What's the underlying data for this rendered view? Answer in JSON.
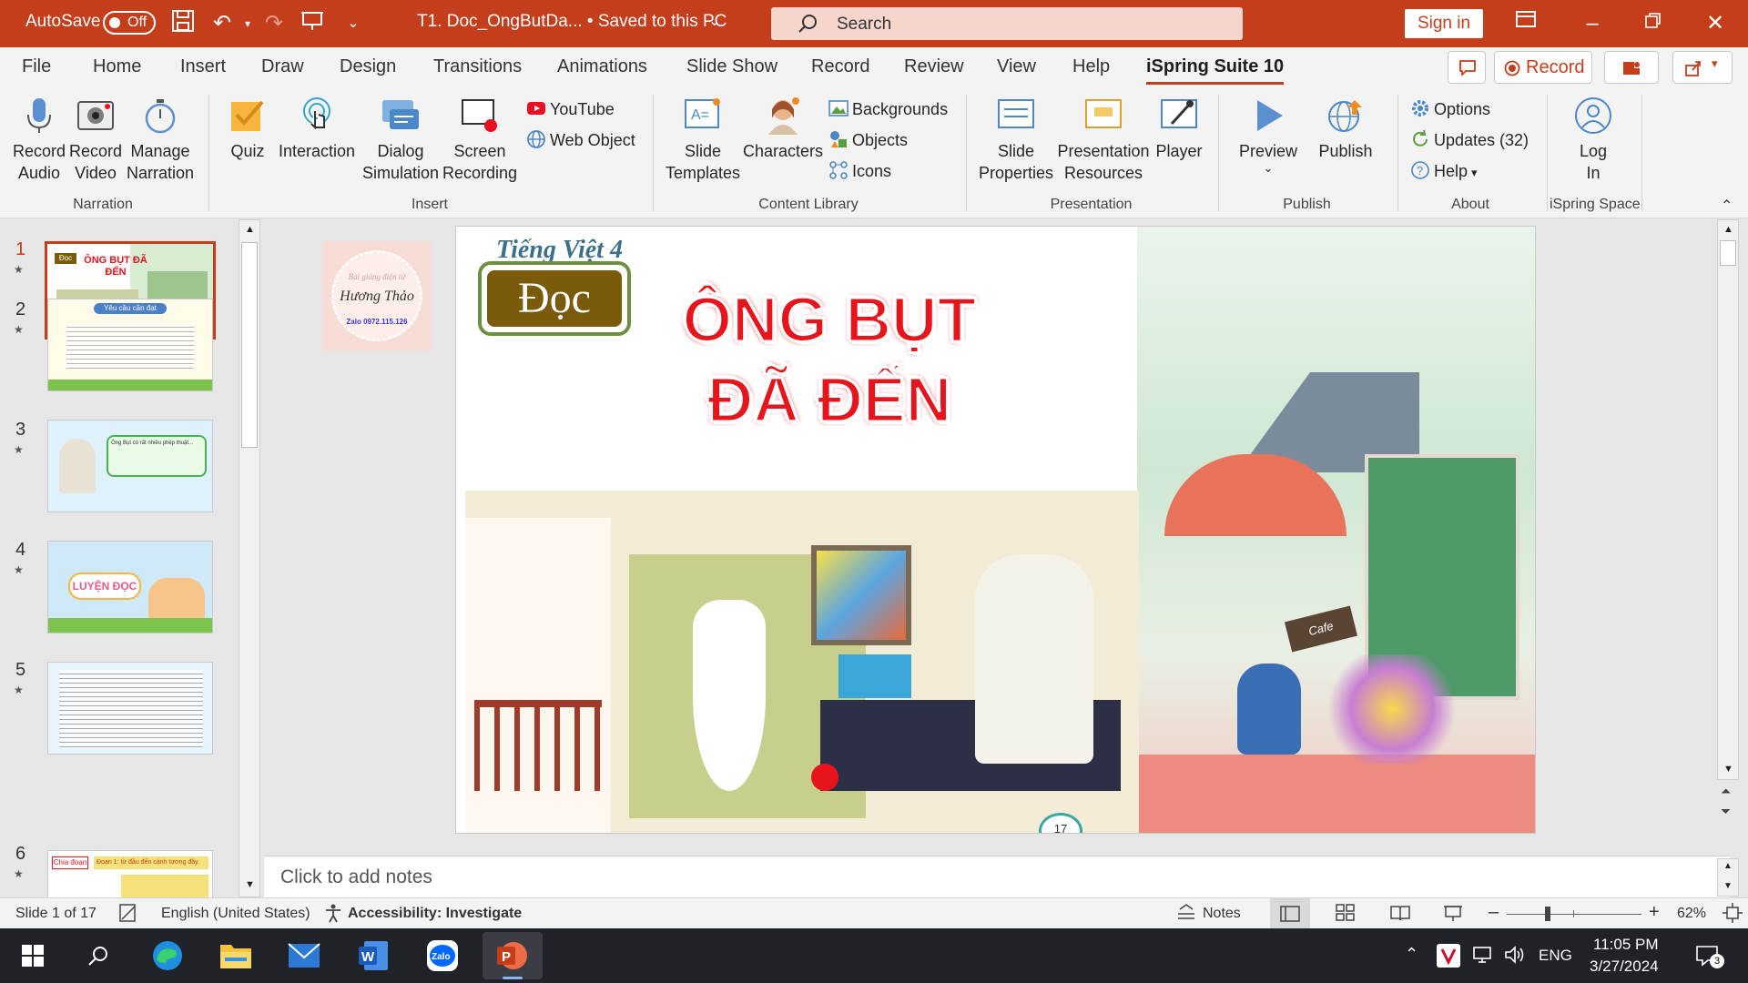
{
  "titlebar": {
    "autosave_label": "AutoSave",
    "autosave_state": "Off",
    "document_title": "T1. Doc_OngButDa...  •  Saved to this PC",
    "search_placeholder": "Search",
    "signin_label": "Sign in"
  },
  "menu": {
    "tabs": [
      "File",
      "Home",
      "Insert",
      "Draw",
      "Design",
      "Transitions",
      "Animations",
      "Slide Show",
      "Record",
      "Review",
      "View",
      "Help",
      "iSpring Suite 10"
    ],
    "active_tab": "iSpring Suite 10",
    "record_label": "Record"
  },
  "ribbon": {
    "narration": {
      "group": "Narration",
      "record_audio": "Record\nAudio",
      "record_video": "Record\nVideo",
      "manage_narration": "Manage\nNarration"
    },
    "insert": {
      "group": "Insert",
      "quiz": "Quiz",
      "interaction": "Interaction",
      "dialog_simulation": "Dialog\nSimulation",
      "screen_recording": "Screen\nRecording",
      "youtube": "YouTube",
      "web_object": "Web Object"
    },
    "content_library": {
      "group": "Content Library",
      "slide_templates": "Slide\nTemplates",
      "characters": "Characters",
      "backgrounds": "Backgrounds",
      "objects": "Objects",
      "icons": "Icons"
    },
    "presentation": {
      "group": "Presentation",
      "slide_properties": "Slide\nProperties",
      "presentation_resources": "Presentation\nResources",
      "player": "Player"
    },
    "publish": {
      "group": "Publish",
      "preview": "Preview",
      "publish": "Publish"
    },
    "about": {
      "group": "About",
      "options": "Options",
      "updates": "Updates (32)",
      "help": "Help"
    },
    "ispring_space": {
      "group": "iSpring Space",
      "log_in": "Log\nIn"
    }
  },
  "thumbnails": [
    {
      "num": "1",
      "title": "ÔNG BỤT ĐÃ ĐẾN",
      "tag": "Đọc"
    },
    {
      "num": "2",
      "title": "Yêu cầu cần đạt",
      "tag": ""
    },
    {
      "num": "3",
      "title": "Ông Bụt có rất nhiều phép thuật...",
      "tag": ""
    },
    {
      "num": "4",
      "title": "LUYỆN ĐỌC",
      "tag": ""
    },
    {
      "num": "5",
      "title": "",
      "tag": ""
    },
    {
      "num": "6",
      "title": "Chia đoạn",
      "tag": "Đoạn 1: từ đầu đến cánh tương đây."
    }
  ],
  "slide": {
    "series_label": "Tiếng Việt 4",
    "lesson_badge": "Đọc",
    "title_line1": "ÔNG BỤT",
    "title_line2": "ĐÃ ĐẾN",
    "stamp_line1": "Bài giảng điện tử",
    "stamp_line2": "Hương Thảo",
    "stamp_line3": "Zalo 0972.115.126",
    "page_number": "17",
    "cafe_sign": "Cafe"
  },
  "notes_placeholder": "Click to add notes",
  "status": {
    "slide_info": "Slide 1 of 17",
    "language": "English (United States)",
    "accessibility": "Accessibility: Investigate",
    "notes": "Notes",
    "zoom": "62%"
  },
  "taskbar": {
    "lang": "ENG",
    "time": "11:05 PM",
    "date": "3/27/2024",
    "notif_count": "3"
  },
  "colors": {
    "accent": "#c43e1c",
    "slide_title": "#e8141b",
    "badge": "#7a5a0b"
  }
}
